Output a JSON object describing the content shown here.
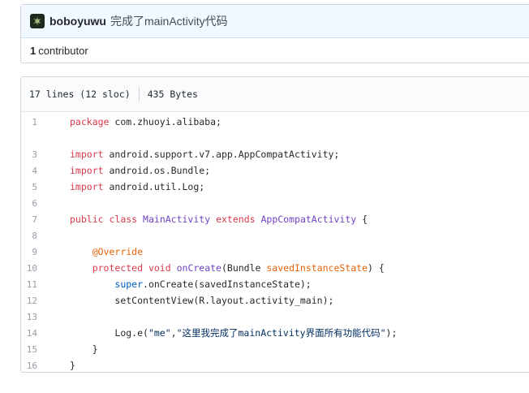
{
  "commit": {
    "author": "boboyuwu",
    "message": "完成了mainActivity代码",
    "contributors_count": "1",
    "contributors_label": "contributor"
  },
  "file": {
    "lines_info": "17 lines (12 sloc)",
    "size": "435 Bytes"
  },
  "code_lines": [
    {
      "n": "1"
    },
    {
      "n": ""
    },
    {
      "n": "3"
    },
    {
      "n": "4"
    },
    {
      "n": "5"
    },
    {
      "n": "6"
    },
    {
      "n": "7"
    },
    {
      "n": "8"
    },
    {
      "n": "9"
    },
    {
      "n": "10"
    },
    {
      "n": "11"
    },
    {
      "n": "12"
    },
    {
      "n": "13"
    },
    {
      "n": "14"
    },
    {
      "n": "15"
    },
    {
      "n": "16"
    }
  ],
  "code": {
    "l1_kw": "package",
    "l1_rest": " com.zhuoyi.alibaba;",
    "l3_kw": "import",
    "l3_rest": " android.support.v7.app.AppCompatActivity;",
    "l4_kw": "import",
    "l4_rest": " android.os.Bundle;",
    "l5_kw": "import",
    "l5_rest": " android.util.Log;",
    "l7_kw1": "public",
    "l7_kw2": "class",
    "l7_cls": "MainActivity",
    "l7_kw3": "extends",
    "l7_cls2": "AppCompatActivity",
    "l7_end": " {",
    "l9_ann": "@Override",
    "l10_kw1": "protected",
    "l10_kw2": "void",
    "l10_fn": "onCreate",
    "l10_p1": "(Bundle ",
    "l10_prm": "savedInstanceState",
    "l10_end": ") {",
    "l11_kw": "super",
    "l11_rest": ".onCreate(savedInstanceState);",
    "l12_rest": "setContentView(R.layout.activity_main);",
    "l14_pre": "Log.e(",
    "l14_s1": "\"me\"",
    "l14_comma": ",",
    "l14_s2": "\"这里我完成了mainActivity界面所有功能代码\"",
    "l14_end": ");",
    "l15_rest": "}",
    "l16_rest": "}"
  }
}
